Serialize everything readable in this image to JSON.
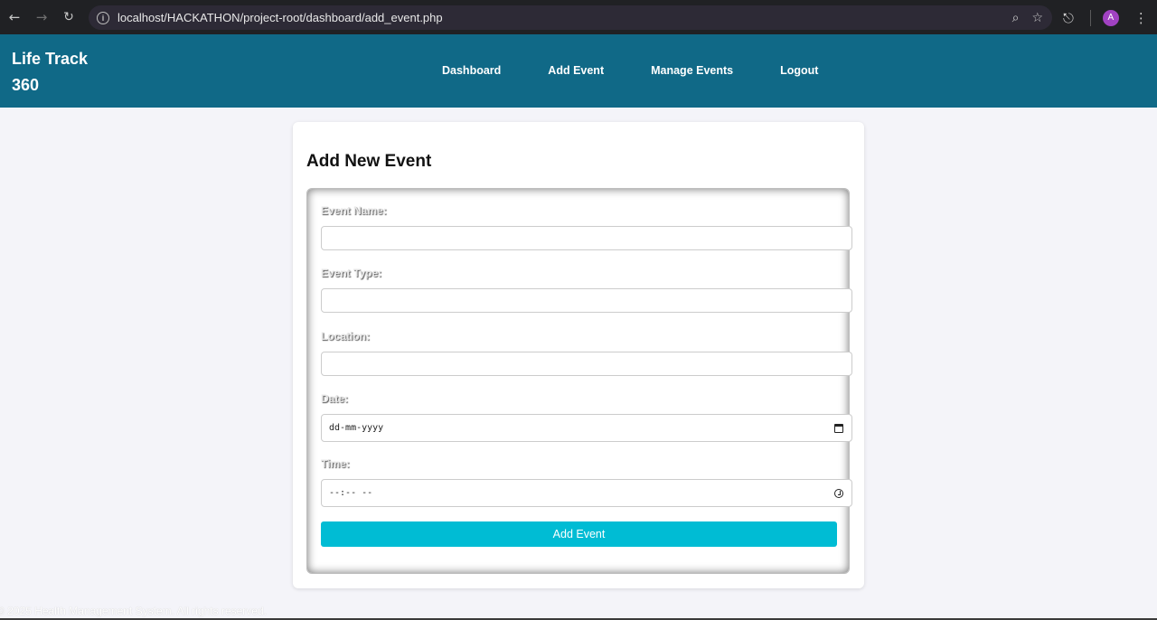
{
  "browser": {
    "url": "localhost/HACKATHON/project-root/dashboard/add_event.php",
    "profile_initial": "A",
    "icons": {
      "back": "arrow-left-icon",
      "forward": "arrow-right-icon",
      "reload": "reload-icon",
      "site_info": "info-icon",
      "zoom": "magnifier-icon",
      "bookmark": "star-icon",
      "extensions": "puzzle-icon",
      "menu": "kebab-menu-icon"
    }
  },
  "header": {
    "brand": "Life Track 360",
    "nav": [
      "Dashboard",
      "Add Event",
      "Manage Events",
      "Logout"
    ],
    "background": "#106987"
  },
  "form": {
    "title": "Add New Event",
    "fields": [
      {
        "label": "Event Name:",
        "value": ""
      },
      {
        "label": "Event Type:",
        "value": ""
      },
      {
        "label": "Location:",
        "value": ""
      },
      {
        "label": "Date:",
        "value": "dd-mm-yyyy"
      },
      {
        "label": "Time:",
        "value": "--:-- --"
      }
    ],
    "submit_label": "Add Event",
    "button_color": "#00bcd4"
  },
  "footer": {
    "text": "© 2025 Health Management System. All rights reserved."
  }
}
